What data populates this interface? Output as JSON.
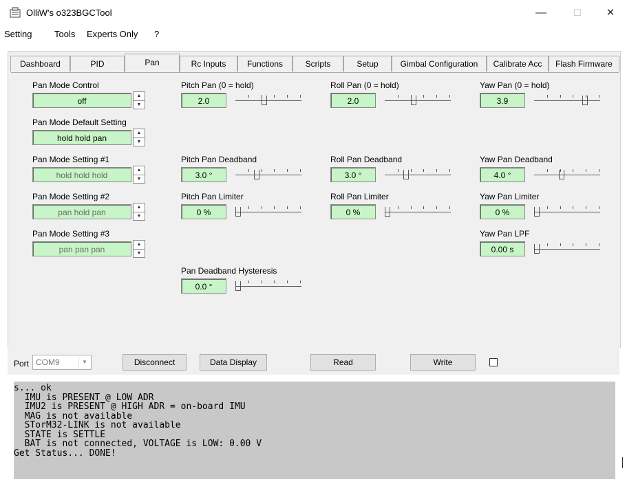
{
  "window": {
    "title": "OlliW's o323BGCTool",
    "minimize": "—",
    "maximize": "☐",
    "close": "✕"
  },
  "menu": {
    "items": [
      "Setting",
      "Tools",
      "Experts Only",
      "?"
    ]
  },
  "tabs": [
    {
      "label": "Dashboard"
    },
    {
      "label": "PID"
    },
    {
      "label": "Pan",
      "active": true
    },
    {
      "label": "Rc Inputs"
    },
    {
      "label": "Functions"
    },
    {
      "label": "Scripts"
    },
    {
      "label": "Setup"
    },
    {
      "label": "Gimbal Configuration"
    },
    {
      "label": "Calibrate Acc"
    },
    {
      "label": "Flash Firmware"
    }
  ],
  "pan_mode": {
    "control": {
      "label": "Pan Mode Control",
      "value": "off"
    },
    "default": {
      "label": "Pan Mode Default Setting",
      "value": "hold hold pan"
    },
    "setting1": {
      "label": "Pan Mode Setting #1",
      "value": "hold hold hold"
    },
    "setting2": {
      "label": "Pan Mode Setting #2",
      "value": "pan hold pan"
    },
    "setting3": {
      "label": "Pan Mode Setting #3",
      "value": "pan pan pan"
    }
  },
  "pitch": {
    "pan": {
      "label": "Pitch Pan (0 = hold)",
      "value": "2.0",
      "level": 0.42
    },
    "deadband": {
      "label": "Pitch Pan Deadband",
      "value": "3.0 °",
      "level": 0.3
    },
    "limiter": {
      "label": "Pitch Pan Limiter",
      "value": "0 %",
      "level": 0.0
    }
  },
  "roll": {
    "pan": {
      "label": "Roll Pan (0 = hold)",
      "value": "2.0",
      "level": 0.42
    },
    "deadband": {
      "label": "Roll Pan Deadband",
      "value": "3.0 °",
      "level": 0.3
    },
    "limiter": {
      "label": "Roll Pan Limiter",
      "value": "0 %",
      "level": 0.0
    }
  },
  "yaw": {
    "pan": {
      "label": "Yaw Pan (0 = hold)",
      "value": "3.9",
      "level": 0.78
    },
    "deadband": {
      "label": "Yaw Pan Deadband",
      "value": "4.0 °",
      "level": 0.4
    },
    "limiter": {
      "label": "Yaw Pan Limiter",
      "value": "0 %",
      "level": 0.0
    },
    "lpf": {
      "label": "Yaw Pan LPF",
      "value": "0.00 s",
      "level": 0.0
    }
  },
  "hysteresis": {
    "label": "Pan Deadband Hysteresis",
    "value": "0.0 °",
    "level": 0.0
  },
  "bottom": {
    "port_label": "Port",
    "port_value": "COM9",
    "disconnect": "Disconnect",
    "data_display": "Data Display",
    "read": "Read",
    "write": "Write"
  },
  "log": {
    "lines": [
      "s... ok",
      "  IMU is PRESENT @ LOW ADR",
      "  IMU2 is PRESENT @ HIGH ADR = on-board IMU",
      "  MAG is not available",
      "  STorM32-LINK is not available",
      "  STATE is SETTLE",
      "  BAT is not connected, VOLTAGE is LOW: 0.00 V",
      "Get Status... DONE!"
    ]
  },
  "colors": {
    "value_bg": "#c7f5c7",
    "panel_bg": "#f0f0f0",
    "log_bg": "#c8c8c8"
  }
}
